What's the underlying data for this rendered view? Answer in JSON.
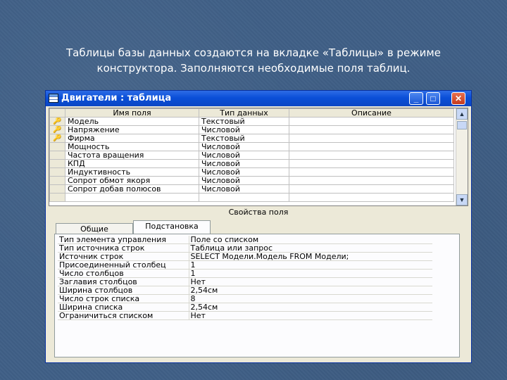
{
  "caption": {
    "line1": "Таблицы базы данных создаются на вкладке «Таблицы» в режиме",
    "line2": "конструктора. Заполняются необходимые поля таблиц."
  },
  "window": {
    "title": "Двигатели : таблица",
    "icon": "table-icon",
    "controls": [
      "minimize-icon",
      "maximize-icon",
      "close-icon"
    ]
  },
  "fields_table": {
    "headers": {
      "name": "Имя поля",
      "type": "Тип данных",
      "description": "Описание"
    },
    "rows": [
      {
        "key": true,
        "name": "Модель",
        "type": "Текстовый",
        "description": ""
      },
      {
        "key": true,
        "name": "Напряжение",
        "type": "Числовой",
        "description": ""
      },
      {
        "key": true,
        "name": "Фирма",
        "type": "Текстовый",
        "description": ""
      },
      {
        "key": false,
        "name": "Мощность",
        "type": "Числовой",
        "description": ""
      },
      {
        "key": false,
        "name": "Частота вращения",
        "type": "Числовой",
        "description": ""
      },
      {
        "key": false,
        "name": "КПД",
        "type": "Числовой",
        "description": ""
      },
      {
        "key": false,
        "name": "Индуктивность",
        "type": "Числовой",
        "description": ""
      },
      {
        "key": false,
        "name": "Сопрот обмот якоря",
        "type": "Числовой",
        "description": ""
      },
      {
        "key": false,
        "name": "Сопрот добав полюсов",
        "type": "Числовой",
        "description": ""
      }
    ],
    "key_glyph": "🔑"
  },
  "field_properties": {
    "title": "Свойства поля",
    "tabs": [
      {
        "label": "Общие",
        "active": false
      },
      {
        "label": "Подстановка",
        "active": true
      }
    ],
    "rows": [
      {
        "name": "Тип элемента управления",
        "value": "Поле со списком"
      },
      {
        "name": "Тип источника строк",
        "value": "Таблица или запрос"
      },
      {
        "name": "Источник строк",
        "value": "SELECT Модели.Модель FROM Модели;"
      },
      {
        "name": "Присоединенный столбец",
        "value": "1"
      },
      {
        "name": "Число столбцов",
        "value": "1"
      },
      {
        "name": "Заглавия столбцов",
        "value": "Нет"
      },
      {
        "name": "Ширина столбцов",
        "value": "2,54см"
      },
      {
        "name": "Число строк списка",
        "value": "8"
      },
      {
        "name": "Ширина списка",
        "value": "2,54см"
      },
      {
        "name": "Ограничиться списком",
        "value": "Нет"
      }
    ]
  }
}
